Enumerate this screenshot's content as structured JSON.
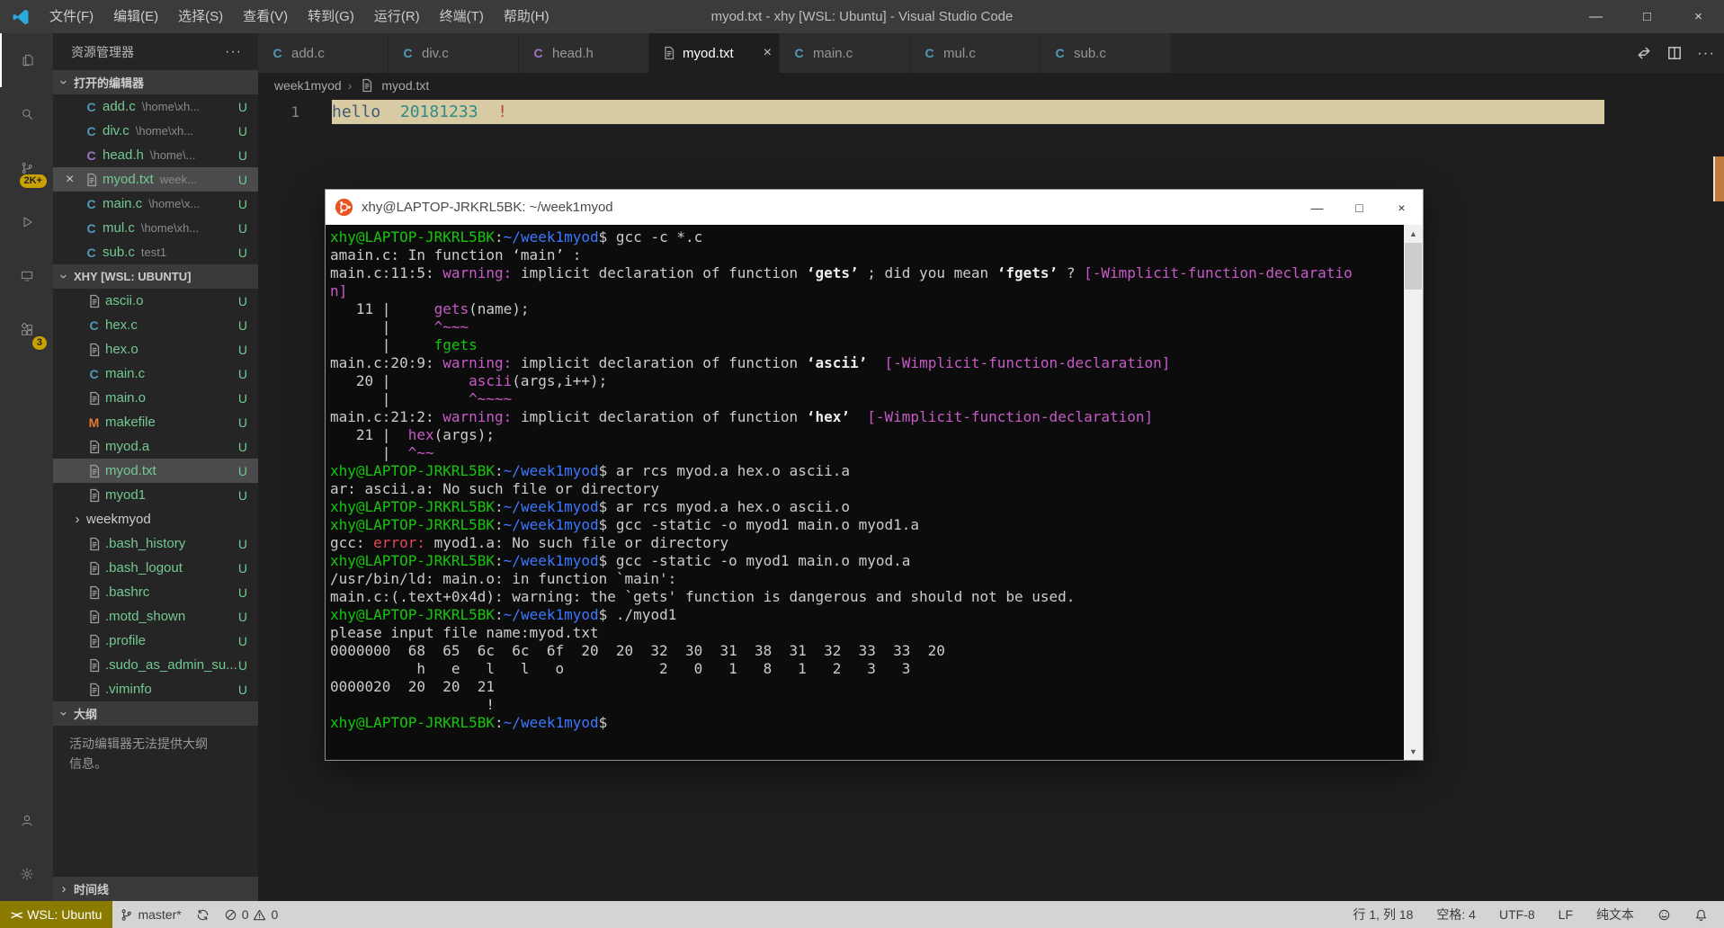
{
  "colors": {
    "untracked": "#73c991",
    "badge_bg": "#c9a100",
    "remote_bg": "#8a7a00",
    "statusbar_bg": "#d4d4d4",
    "statusbar_fg": "#3c3c3c",
    "line_highlight": "#d8cba3",
    "ruler_mark": "#c07b3a",
    "c_icon": "#519aba",
    "h_icon": "#a074c4",
    "makefile_icon": "#e37933"
  },
  "title_bar": {
    "title": "myod.txt - xhy [WSL: Ubuntu] - Visual Studio Code",
    "menus": [
      "文件(F)",
      "编辑(E)",
      "选择(S)",
      "查看(V)",
      "转到(G)",
      "运行(R)",
      "终端(T)",
      "帮助(H)"
    ],
    "controls": {
      "minimize": "—",
      "maximize": "□",
      "close": "×"
    }
  },
  "activity_bar": {
    "items": [
      {
        "name": "explorer",
        "icon": "files-icon",
        "active": true
      },
      {
        "name": "search",
        "icon": "search-icon"
      },
      {
        "name": "source-control",
        "icon": "source-control-icon",
        "badge": "2K+"
      },
      {
        "name": "run-debug",
        "icon": "run-debug-icon"
      },
      {
        "name": "remote-explorer",
        "icon": "remote-explorer-icon"
      },
      {
        "name": "extensions",
        "icon": "extensions-icon",
        "badge": "3"
      }
    ],
    "bottom": [
      {
        "name": "account",
        "icon": "account-icon"
      },
      {
        "name": "settings",
        "icon": "gear-icon"
      }
    ]
  },
  "sidebar": {
    "title": "资源管理器",
    "more": "···",
    "open_editors": {
      "label": "打开的编辑器",
      "items": [
        {
          "name": "add.c",
          "desc": "\\home\\xh...",
          "badge": "U",
          "icon": "c-icon"
        },
        {
          "name": "div.c",
          "desc": "\\home\\xh...",
          "badge": "U",
          "icon": "c-icon"
        },
        {
          "name": "head.h",
          "desc": "\\home\\...",
          "badge": "U",
          "icon": "h-icon"
        },
        {
          "name": "myod.txt",
          "desc": "week...",
          "badge": "U",
          "icon": "file-icon",
          "active": true
        },
        {
          "name": "main.c",
          "desc": "\\home\\x...",
          "badge": "U",
          "icon": "c-icon"
        },
        {
          "name": "mul.c",
          "desc": "\\home\\xh...",
          "badge": "U",
          "icon": "c-icon"
        },
        {
          "name": "sub.c",
          "desc": "test1",
          "badge": "U",
          "icon": "c-icon"
        }
      ]
    },
    "files": {
      "label": "XHY [WSL: UBUNTU]",
      "items": [
        {
          "name": "ascii.o",
          "badge": "U",
          "icon": "file-icon"
        },
        {
          "name": "hex.c",
          "badge": "U",
          "icon": "c-icon"
        },
        {
          "name": "hex.o",
          "badge": "U",
          "icon": "file-icon"
        },
        {
          "name": "main.c",
          "badge": "U",
          "icon": "c-icon"
        },
        {
          "name": "main.o",
          "badge": "U",
          "icon": "file-icon"
        },
        {
          "name": "makefile",
          "badge": "U",
          "icon": "makefile-icon"
        },
        {
          "name": "myod.a",
          "badge": "U",
          "icon": "file-icon"
        },
        {
          "name": "myod.txt",
          "badge": "U",
          "icon": "file-icon",
          "selected": true
        },
        {
          "name": "myod1",
          "badge": "U",
          "icon": "file-icon"
        },
        {
          "name": "weekmyod",
          "icon": "folder-icon",
          "folder": true
        },
        {
          "name": ".bash_history",
          "badge": "U",
          "icon": "file-icon"
        },
        {
          "name": ".bash_logout",
          "badge": "U",
          "icon": "file-icon"
        },
        {
          "name": ".bashrc",
          "badge": "U",
          "icon": "file-icon"
        },
        {
          "name": ".motd_shown",
          "badge": "U",
          "icon": "file-icon"
        },
        {
          "name": ".profile",
          "badge": "U",
          "icon": "file-icon"
        },
        {
          "name": ".sudo_as_admin_su...",
          "badge": "U",
          "icon": "file-icon"
        },
        {
          "name": ".viminfo",
          "badge": "U",
          "icon": "file-icon"
        }
      ]
    },
    "outline": {
      "label": "大纲",
      "message": "活动编辑器无法提供大纲信息。"
    },
    "timeline": {
      "label": "时间线"
    }
  },
  "editor": {
    "tabs": [
      {
        "label": "add.c",
        "icon": "c-icon"
      },
      {
        "label": "div.c",
        "icon": "c-icon"
      },
      {
        "label": "head.h",
        "icon": "h-icon"
      },
      {
        "label": "myod.txt",
        "icon": "file-icon",
        "active": true,
        "close": "×"
      },
      {
        "label": "main.c",
        "icon": "c-icon"
      },
      {
        "label": "mul.c",
        "icon": "c-icon"
      },
      {
        "label": "sub.c",
        "icon": "c-icon"
      }
    ],
    "breadcrumb": [
      "week1myod",
      "myod.txt"
    ],
    "line_number": "1",
    "segments": [
      [
        "hello",
        "#3f5875"
      ],
      [
        "  ",
        "#333333"
      ],
      [
        "20181233",
        "#2e8b85"
      ],
      [
        "  ",
        "#333333"
      ],
      [
        "!",
        "#b5493f"
      ]
    ]
  },
  "status_bar": {
    "remote": "WSL: Ubuntu",
    "branch": "master*",
    "errors": "0",
    "warnings": "0",
    "right": [
      "行 1, 列 18",
      "空格: 4",
      "UTF-8",
      "LF",
      "纯文本"
    ]
  },
  "terminal": {
    "title": "xhy@LAPTOP-JRKRL5BK: ~/week1myod",
    "controls": {
      "minimize": "—",
      "maximize": "□",
      "close": "×"
    },
    "color_map": {
      "f": "#cccccc",
      "g": "#16c60c",
      "b": "#3b78ff",
      "m": "#c75ac8",
      "r": "#e74856",
      "w": "#eeeeee"
    },
    "rows": [
      [
        [
          "g",
          "xhy@LAPTOP-JRKRL5BK"
        ],
        [
          "f",
          ":"
        ],
        [
          "b",
          "~/week1myod"
        ],
        [
          "f",
          "$ gcc -c *.c"
        ]
      ],
      [
        [
          "f",
          "amain.c: In function ‘main’ :"
        ]
      ],
      [
        [
          "f",
          "main.c:11:5: "
        ],
        [
          "m",
          "warning: "
        ],
        [
          "f",
          "implicit declaration of function "
        ],
        [
          "w",
          "‘gets’"
        ],
        [
          "f",
          " ; did you mean "
        ],
        [
          "w",
          "‘fgets’"
        ],
        [
          "f",
          " ? "
        ],
        [
          "m",
          "[-Wimplicit-function-declaratio"
        ]
      ],
      [
        [
          "m",
          "n]"
        ]
      ],
      [
        [
          "f",
          "   11 |     "
        ],
        [
          "m",
          "gets"
        ],
        [
          "f",
          "(name);"
        ]
      ],
      [
        [
          "f",
          "      |     "
        ],
        [
          "m",
          "^~~~"
        ]
      ],
      [
        [
          "f",
          "      |     "
        ],
        [
          "g",
          "fgets"
        ]
      ],
      [
        [
          "f",
          "main.c:20:9: "
        ],
        [
          "m",
          "warning: "
        ],
        [
          "f",
          "implicit declaration of function "
        ],
        [
          "w",
          "‘ascii’"
        ],
        [
          "f",
          "  "
        ],
        [
          "m",
          "[-Wimplicit-function-declaration]"
        ]
      ],
      [
        [
          "f",
          "   20 |         "
        ],
        [
          "m",
          "ascii"
        ],
        [
          "f",
          "(args,i++);"
        ]
      ],
      [
        [
          "f",
          "      |         "
        ],
        [
          "m",
          "^~~~~"
        ]
      ],
      [
        [
          "f",
          "main.c:21:2: "
        ],
        [
          "m",
          "warning: "
        ],
        [
          "f",
          "implicit declaration of function "
        ],
        [
          "w",
          "‘hex’"
        ],
        [
          "f",
          "  "
        ],
        [
          "m",
          "[-Wimplicit-function-declaration]"
        ]
      ],
      [
        [
          "f",
          "   21 |  "
        ],
        [
          "m",
          "hex"
        ],
        [
          "f",
          "(args);"
        ]
      ],
      [
        [
          "f",
          "      |  "
        ],
        [
          "m",
          "^~~"
        ]
      ],
      [
        [
          "g",
          "xhy@LAPTOP-JRKRL5BK"
        ],
        [
          "f",
          ":"
        ],
        [
          "b",
          "~/week1myod"
        ],
        [
          "f",
          "$ ar rcs myod.a hex.o ascii.a"
        ]
      ],
      [
        [
          "f",
          "ar: ascii.a: No such file or directory"
        ]
      ],
      [
        [
          "g",
          "xhy@LAPTOP-JRKRL5BK"
        ],
        [
          "f",
          ":"
        ],
        [
          "b",
          "~/week1myod"
        ],
        [
          "f",
          "$ ar rcs myod.a hex.o ascii.o"
        ]
      ],
      [
        [
          "g",
          "xhy@LAPTOP-JRKRL5BK"
        ],
        [
          "f",
          ":"
        ],
        [
          "b",
          "~/week1myod"
        ],
        [
          "f",
          "$ gcc -static -o myod1 main.o myod1.a"
        ]
      ],
      [
        [
          "f",
          "gcc: "
        ],
        [
          "r",
          "error: "
        ],
        [
          "f",
          "myod1.a: No such file or directory"
        ]
      ],
      [
        [
          "g",
          "xhy@LAPTOP-JRKRL5BK"
        ],
        [
          "f",
          ":"
        ],
        [
          "b",
          "~/week1myod"
        ],
        [
          "f",
          "$ gcc -static -o myod1 main.o myod.a"
        ]
      ],
      [
        [
          "f",
          "/usr/bin/ld: main.o: in function `main':"
        ]
      ],
      [
        [
          "f",
          "main.c:(.text+0x4d): warning: the `gets' function is dangerous and should not be used."
        ]
      ],
      [
        [
          "g",
          "xhy@LAPTOP-JRKRL5BK"
        ],
        [
          "f",
          ":"
        ],
        [
          "b",
          "~/week1myod"
        ],
        [
          "f",
          "$ ./myod1"
        ]
      ],
      [
        [
          "f",
          "please input file name:myod.txt"
        ]
      ],
      [
        [
          "f",
          "0000000  68  65  6c  6c  6f  20  20  32  30  31  38  31  32  33  33  20"
        ]
      ],
      [
        [
          "f",
          "          h   e   l   l   o           2   0   1   8   1   2   3   3"
        ]
      ],
      [
        [
          "f",
          "0000020  20  20  21"
        ]
      ],
      [
        [
          "f",
          "                  !"
        ]
      ],
      [
        [
          "g",
          "xhy@LAPTOP-JRKRL5BK"
        ],
        [
          "f",
          ":"
        ],
        [
          "b",
          "~/week1myod"
        ],
        [
          "f",
          "$"
        ]
      ]
    ]
  }
}
